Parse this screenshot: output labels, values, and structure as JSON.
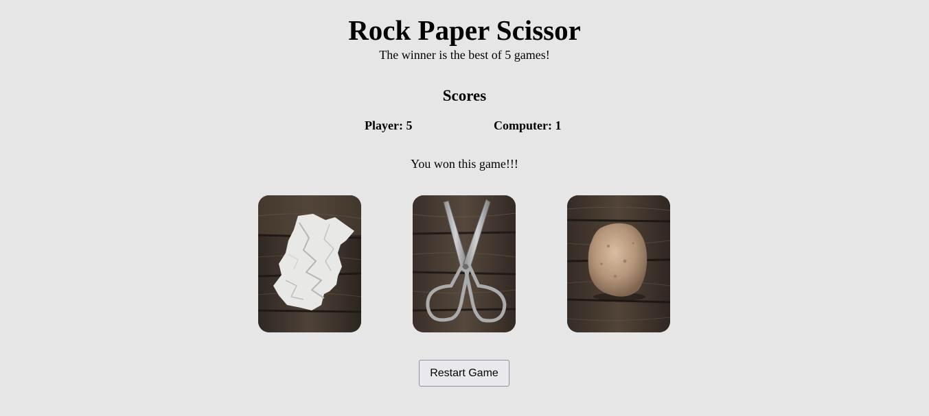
{
  "header": {
    "title": "Rock Paper Scissor",
    "subtitle": "The winner is the best of 5 games!"
  },
  "scores": {
    "heading": "Scores",
    "player_label": "Player: 5",
    "computer_label": "Computer: 1"
  },
  "result": {
    "message": "You won this game!!!"
  },
  "choices": [
    {
      "name": "paper",
      "icon": "paper-icon"
    },
    {
      "name": "scissors",
      "icon": "scissors-icon"
    },
    {
      "name": "rock",
      "icon": "rock-icon"
    }
  ],
  "controls": {
    "restart_label": "Restart Game"
  },
  "colors": {
    "background": "#e6e6e6",
    "wood_dark": "#3b322b",
    "wood_light": "#5a4c40",
    "button_bg": "#e9e9ed",
    "button_border": "#8f8f9d"
  }
}
